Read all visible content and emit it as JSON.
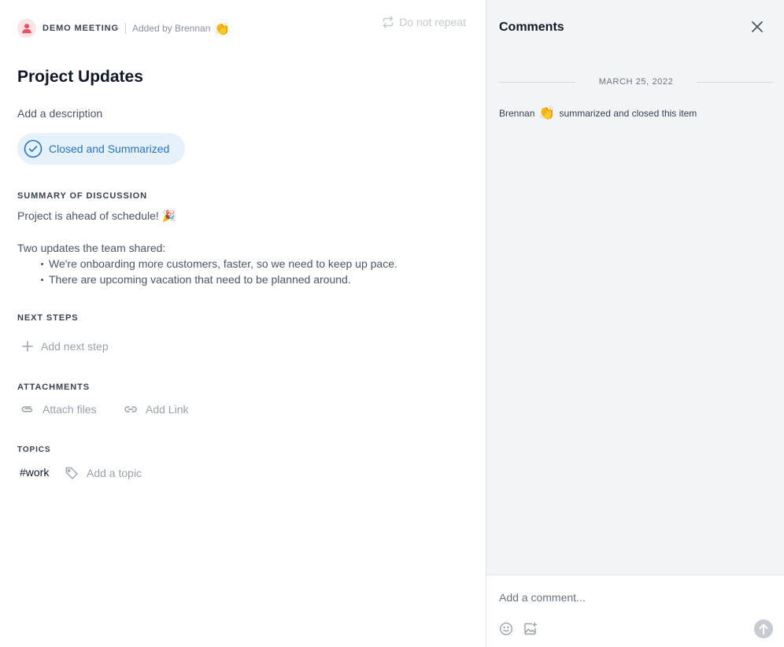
{
  "header": {
    "meeting_label": "DEMO MEETING",
    "added_by": "Added by Brennan",
    "added_emoji": "👏",
    "repeat_label": "Do not repeat"
  },
  "item": {
    "title": "Project Updates",
    "description_placeholder": "Add a description",
    "status_label": "Closed and Summarized"
  },
  "summary": {
    "heading": "SUMMARY OF DISCUSSION",
    "line1": "Project is ahead of schedule!",
    "line1_emoji": "🎉",
    "line2": "Two updates the team shared:",
    "bullets": [
      "We're onboarding more customers, faster, so we need to keep up pace.",
      "There are upcoming vacation that need to be planned around."
    ]
  },
  "next_steps": {
    "heading": "NEXT STEPS",
    "add_label": "Add next step"
  },
  "attachments": {
    "heading": "ATTACHMENTS",
    "attach_label": "Attach files",
    "link_label": "Add Link"
  },
  "topics": {
    "heading": "TOPICS",
    "tags": [
      "#work"
    ],
    "add_label": "Add a topic"
  },
  "comments": {
    "title": "Comments",
    "date": "MARCH 25, 2022",
    "activity_user": "Brennan",
    "activity_emoji": "👏",
    "activity_text": "summarized and closed this item",
    "input_placeholder": "Add a comment..."
  },
  "colors": {
    "accent": "#1f76c9",
    "status_bg": "#e6f1fc",
    "avatar": "#e8506a",
    "panel_bg": "#f3f4f6"
  }
}
